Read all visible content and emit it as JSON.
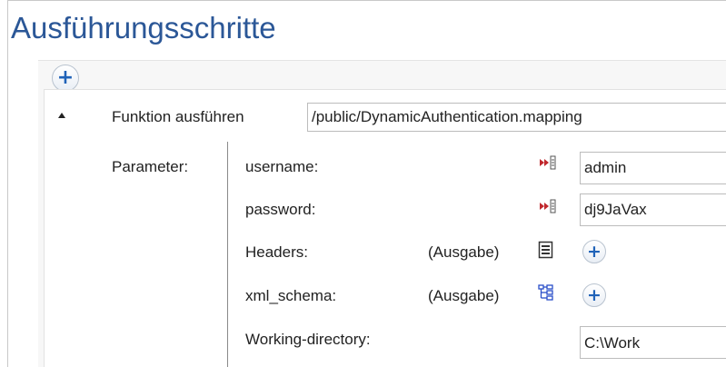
{
  "page": {
    "title": "Ausführungsschritte"
  },
  "step": {
    "action_label": "Funktion ausführen",
    "function_path": "/public/DynamicAuthentication.mapping",
    "parameters_label": "Parameter:"
  },
  "parameters": [
    {
      "name": "username:",
      "kind": "input",
      "value": "admin"
    },
    {
      "name": "password:",
      "kind": "input",
      "value": "dj9JaVax"
    },
    {
      "name": "Headers:",
      "kind": "output",
      "direction": "(Ausgabe)",
      "icon": "document-list-icon"
    },
    {
      "name": "xml_schema:",
      "kind": "output",
      "direction": "(Ausgabe)",
      "icon": "xml-tree-icon"
    },
    {
      "name": "Working-directory:",
      "kind": "input",
      "value": "C:\\Work"
    }
  ],
  "colors": {
    "title": "#2b5797",
    "accent": "#1f62b8",
    "input_icon": "#c0282d"
  }
}
